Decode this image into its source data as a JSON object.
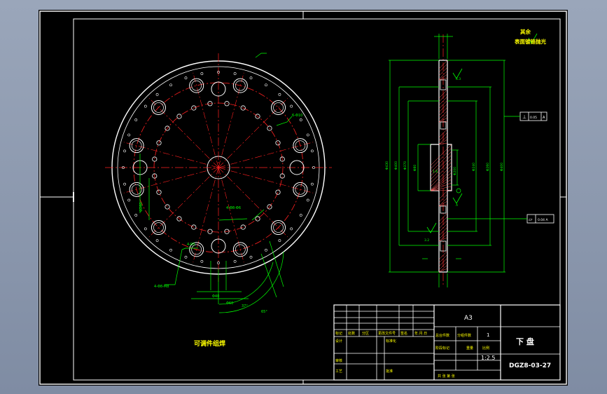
{
  "colors": {
    "border": "#ffffff",
    "geometry": "#ffffff",
    "centerline": "#ff2020",
    "dimension": "#00ff00",
    "text_yellow": "#ffff00"
  },
  "notes": {
    "surface_line1": "其余",
    "surface_line2": "表面镀铬抛光",
    "assembly_note": "可调件组焊"
  },
  "title_block": {
    "format": "A3",
    "part_name": "下 盘",
    "drawing_no": "DGZ8-03-27",
    "scale": "1:2.5",
    "count": "1",
    "headers": {
      "mark": "标记",
      "qty": "处数",
      "zone": "分区",
      "change_doc": "更改文件号",
      "sign": "签名",
      "date": "年.月.日",
      "design": "设计",
      "standardize": "标准化",
      "review": "审核",
      "process": "工艺",
      "approve": "批准",
      "total_weight": "总台件数",
      "per_weight": "分组件数",
      "stage_mark": "阶段标记",
      "weight": "重量",
      "ratio": "比例",
      "sheets": "共  张  第  张"
    }
  },
  "dimensions": {
    "d1": "4-R5",
    "d2": "4-Φ8-M8",
    "d3": "4-Φ8-Φ6",
    "d4": "6-Φ10",
    "d5": "Φ40",
    "d6": "Φ60",
    "d7": "37°",
    "d8": "65°",
    "d9": "Φ260",
    "d10": "Φ240",
    "d11": "Φ200",
    "d12": "Φ80",
    "d13": "Φ370",
    "d14": "Φ400",
    "d15": "Φ430",
    "d16": "0.05",
    "d17": "A",
    "d18": "0.04 A",
    "d19": "1.6",
    "d20": "3.2",
    "d21": "6.3",
    "d22": "A"
  }
}
